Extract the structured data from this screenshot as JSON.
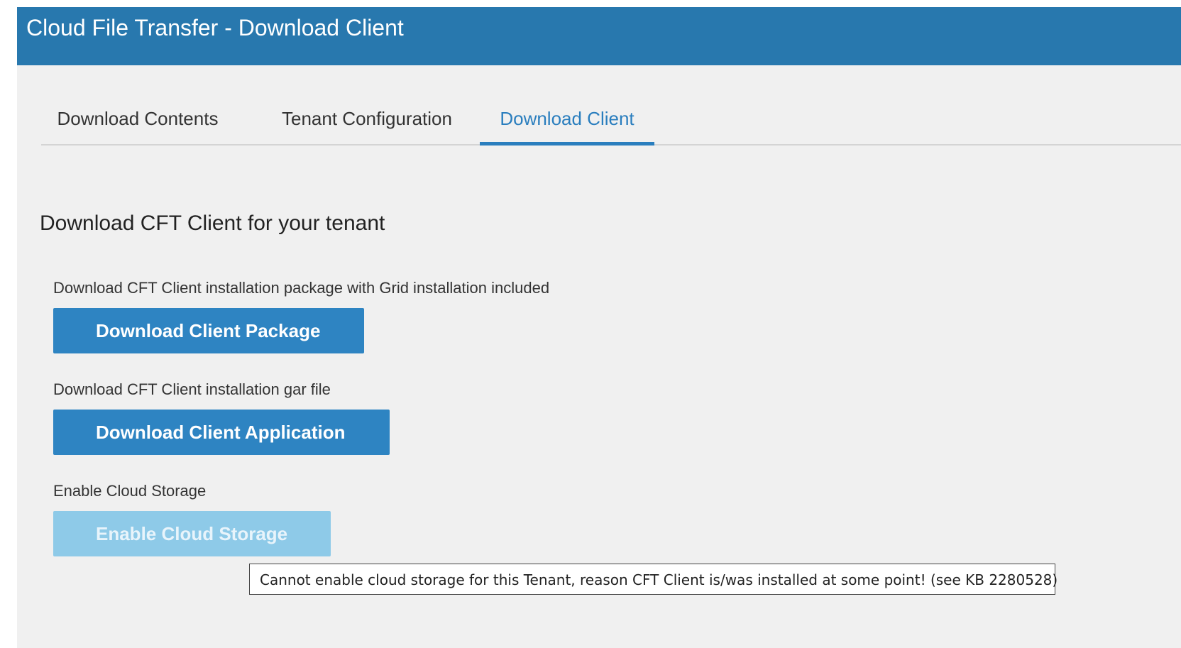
{
  "app": {
    "title": "Cloud File Transfer - Download Client"
  },
  "tabs": [
    {
      "label": "Download Contents",
      "active": false
    },
    {
      "label": "Tenant Configuration",
      "active": false
    },
    {
      "label": "Download Client",
      "active": true
    }
  ],
  "section": {
    "title": "Download CFT Client for your tenant"
  },
  "package": {
    "description": "Download CFT Client installation package with Grid installation included",
    "button": "Download Client Package"
  },
  "application": {
    "description": "Download CFT Client installation gar file",
    "button": "Download Client Application"
  },
  "cloud_storage": {
    "description": "Enable Cloud Storage",
    "button": "Enable Cloud Storage",
    "enabled": false
  },
  "tooltip": {
    "text": "Cannot enable cloud storage for this Tenant, reason CFT Client is/was installed at some point! (see KB 2280528)"
  },
  "colors": {
    "header": "#2878ae",
    "accent": "#2a7ebe",
    "button": "#2e84c2",
    "button_disabled": "#8ecae8",
    "background": "#f0f0f0"
  }
}
